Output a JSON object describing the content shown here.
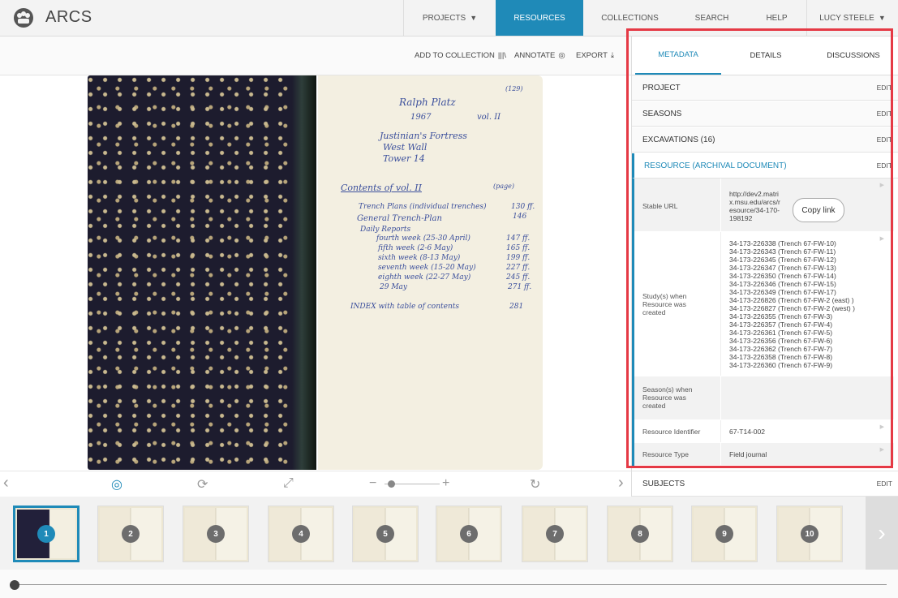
{
  "brand": {
    "name": "ARCS"
  },
  "nav": [
    "PROJECTS",
    "RESOURCES",
    "COLLECTIONS",
    "SEARCH",
    "HELP",
    "LUCY STEELE"
  ],
  "toolbar": {
    "add": "ADD TO COLLECTION",
    "annotate": "ANNOTATE",
    "export": "EXPORT"
  },
  "document": {
    "page_no": "(129)",
    "lines": [
      "Ralph Platz",
      "1967",
      "vol. II",
      "Justinian's Fortress",
      "West Wall",
      "Tower 14",
      "Contents of vol. II",
      "(page)",
      "Trench Plans (individual trenches)",
      "130 ff.",
      "General Trench-Plan",
      "146",
      "Daily Reports",
      "fourth week (25-30 April)",
      "147 ff.",
      "fifth week (2-6 May)",
      "165 ff.",
      "sixth week (8-13 May)",
      "199 ff.",
      "seventh week (15-20 May)",
      "227 ff.",
      "eighth week (22-27 May)",
      "245 ff.",
      "29 May",
      "271 ff.",
      "INDEX with table of contents",
      "281"
    ]
  },
  "panel": {
    "tabs": [
      "METADATA",
      "DETAILS",
      "DISCUSSIONS"
    ],
    "edit": "EDIT",
    "sections": [
      "PROJECT",
      "SEASONS",
      "EXCAVATIONS (16)",
      "RESOURCE (ARCHIVAL DOCUMENT)",
      "SUBJECTS"
    ],
    "stable_url": {
      "label": "Stable URL",
      "value": [
        "http://dev2.matri",
        "x.msu.edu/arcs/r",
        "esource/34-170-",
        "198192"
      ],
      "copy": "Copy link"
    },
    "studies": {
      "label": [
        "Study(s) when",
        "Resource was",
        "created"
      ],
      "value": [
        "34-173-226338 (Trench 67-FW-10)",
        "34-173-226343 (Trench 67-FW-11)",
        "34-173-226345 (Trench 67-FW-12)",
        "34-173-226347 (Trench 67-FW-13)",
        "34-173-226350 (Trench 67-FW-14)",
        "34-173-226346 (Trench 67-FW-15)",
        "34-173-226349 (Trench 67-FW-17)",
        "34-173-226826 (Trench 67-FW-2 (east) )",
        "34-173-226827 (Trench 67-FW-2 (west) )",
        "34-173-226355 (Trench 67-FW-3)",
        "34-173-226357 (Trench 67-FW-4)",
        "34-173-226361 (Trench 67-FW-5)",
        "34-173-226356 (Trench 67-FW-6)",
        "34-173-226362 (Trench 67-FW-7)",
        "34-173-226358 (Trench 67-FW-8)",
        "34-173-226360 (Trench 67-FW-9)"
      ]
    },
    "seasons_row": {
      "label": [
        "Season(s) when",
        "Resource was",
        "created"
      ]
    },
    "identifier": {
      "label": "Resource Identifier",
      "value": "67-T14-002"
    },
    "type": {
      "label": "Resource Type",
      "value": "Field journal"
    }
  },
  "thumbs": [
    "1",
    "2",
    "3",
    "4",
    "5",
    "6",
    "7",
    "8",
    "9",
    "10"
  ],
  "colors": {
    "accent": "#1f8ab8",
    "highlight": "#e53945"
  }
}
